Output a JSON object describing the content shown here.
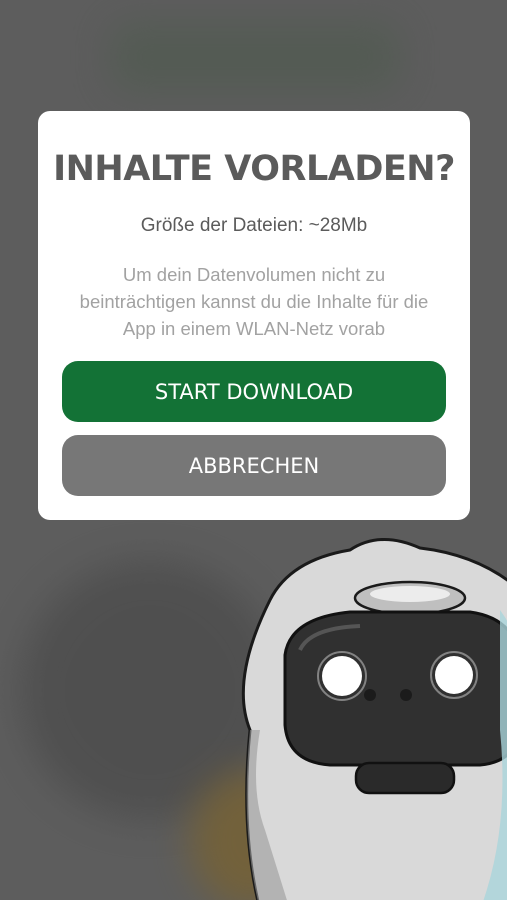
{
  "dialog": {
    "title": "INHALTE VORLADEN?",
    "file_size": "Größe der Dateien: ~28Mb",
    "description": "Um dein Datenvolumen nicht zu beinträchtigen kannst du die Inhalte für die App in einem WLAN-Netz vorab",
    "start_button": "START DOWNLOAD",
    "cancel_button": "ABBRECHEN"
  },
  "colors": {
    "overlay": "#5d5d5d",
    "primary": "#137236",
    "secondary": "#777777",
    "title_text": "#5b5b5b",
    "muted_text": "#a2a2a2"
  },
  "mascot": "robot-mascot"
}
